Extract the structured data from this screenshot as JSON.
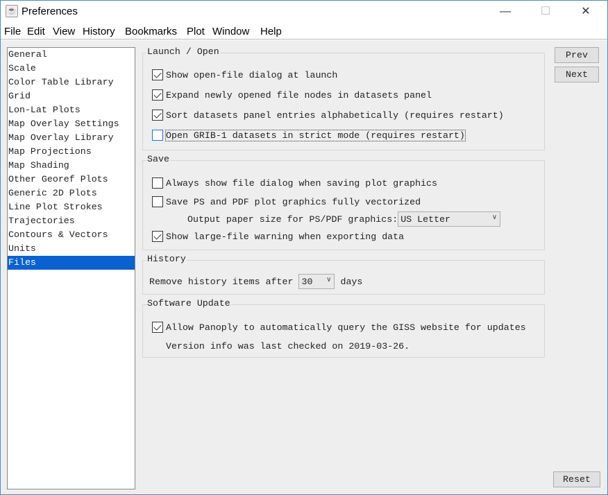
{
  "window": {
    "title": "Preferences",
    "app_icon": "java-icon",
    "controls": [
      "minimize",
      "maximize",
      "close"
    ]
  },
  "menu": [
    "File",
    "Edit",
    "View",
    "History",
    "Bookmarks",
    "Plot",
    "Window",
    "Help"
  ],
  "sidebar": {
    "items": [
      "General",
      "Scale",
      "Color Table Library",
      "Grid",
      "Lon-Lat Plots",
      "Map Overlay Settings",
      "Map Overlay Library",
      "Map Projections",
      "Map Shading",
      "Other Georef Plots",
      "Generic 2D Plots",
      "Line Plot Strokes",
      "Trajectories",
      "Contours & Vectors",
      "Units",
      "Files"
    ],
    "selected": "Files"
  },
  "launch": {
    "title": "Launch / Open",
    "options": [
      {
        "label": "Show open-file dialog at launch",
        "checked": true
      },
      {
        "label": "Expand newly opened file nodes in datasets panel",
        "checked": true
      },
      {
        "label": "Sort datasets panel entries alphabetically (requires restart)",
        "checked": true
      },
      {
        "label": "Open GRIB-1 datasets in strict mode (requires restart)",
        "checked": false
      }
    ]
  },
  "save": {
    "title": "Save",
    "always_dialog": {
      "label": "Always show file dialog when saving plot graphics",
      "checked": false
    },
    "vectorized": {
      "label": "Save PS and PDF plot graphics fully vectorized",
      "checked": false
    },
    "paper_label": "Output paper size for PS/PDF graphics:",
    "paper_value": "US Letter",
    "large_warning": {
      "label": "Show large-file warning when exporting data",
      "checked": true
    }
  },
  "history": {
    "title": "History",
    "label_before": "Remove history items after",
    "days_value": "30",
    "label_after": "days"
  },
  "update": {
    "title": "Software Update",
    "allow": {
      "label": "Allow Panoply to automatically query the GISS website for updates",
      "checked": true
    },
    "version_info": "Version info was last checked on 2019-03-26."
  },
  "buttons": {
    "prev": "Prev",
    "next": "Next",
    "reset": "Reset"
  },
  "colors": {
    "selection": "#0a62d0",
    "accent_border": "#4a8bc7"
  }
}
